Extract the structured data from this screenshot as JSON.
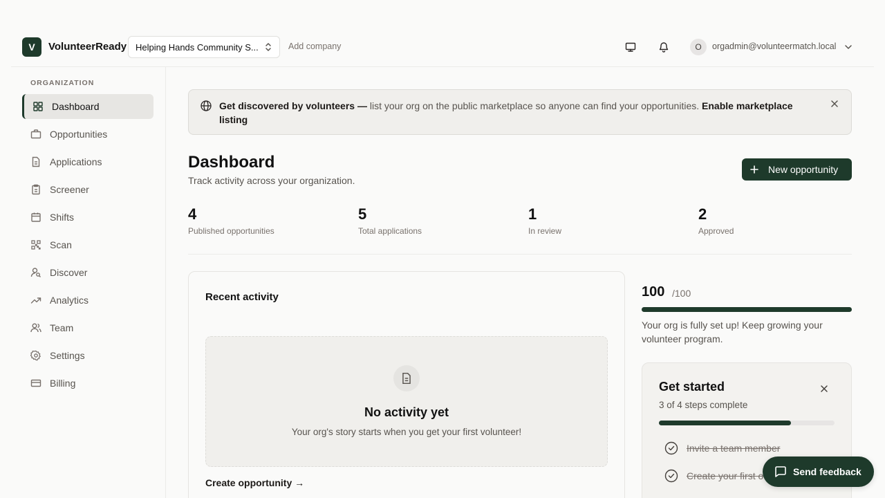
{
  "header": {
    "logo_letter": "V",
    "app_name": "VolunteerReady",
    "company_selected": "Helping Hands Community S...",
    "add_company": "Add company",
    "user_initial": "O",
    "user_email": "orgadmin@volunteermatch.local"
  },
  "sidebar": {
    "heading": "ORGANIZATION",
    "items": [
      {
        "label": "Dashboard",
        "icon": "dashboard-icon",
        "active": true
      },
      {
        "label": "Opportunities",
        "icon": "briefcase-icon"
      },
      {
        "label": "Applications",
        "icon": "document-icon"
      },
      {
        "label": "Screener",
        "icon": "clipboard-icon"
      },
      {
        "label": "Shifts",
        "icon": "calendar-icon"
      },
      {
        "label": "Scan",
        "icon": "qr-code-icon"
      },
      {
        "label": "Discover",
        "icon": "user-search-icon"
      },
      {
        "label": "Analytics",
        "icon": "trend-icon"
      },
      {
        "label": "Team",
        "icon": "users-icon"
      },
      {
        "label": "Settings",
        "icon": "gear-icon"
      },
      {
        "label": "Billing",
        "icon": "credit-card-icon"
      }
    ]
  },
  "banner": {
    "lead": "Get discovered by volunteers —",
    "body": " list your org on the public marketplace so anyone can find your opportunities. ",
    "action": "Enable marketplace listing"
  },
  "page": {
    "title": "Dashboard",
    "subtitle": "Track activity across your organization.",
    "new_button": "New opportunity"
  },
  "stats": [
    {
      "value": "4",
      "label": "Published opportunities"
    },
    {
      "value": "5",
      "label": "Total applications"
    },
    {
      "value": "1",
      "label": "In review"
    },
    {
      "value": "2",
      "label": "Approved"
    }
  ],
  "activity": {
    "title": "Recent activity",
    "empty_title": "No activity yet",
    "empty_sub": "Your org's story starts when you get your first volunteer!",
    "create_link": "Create opportunity →"
  },
  "score": {
    "value": "100",
    "max": "/100",
    "fraction": 1.0,
    "message": "Your org is fully set up! Keep growing your volunteer program."
  },
  "get_started": {
    "title": "Get started",
    "progress_text": "3 of 4 steps complete",
    "fraction": 0.75,
    "steps": [
      {
        "label": "Invite a team member",
        "done": true
      },
      {
        "label": "Create your first o",
        "done": true
      }
    ]
  },
  "feedback": {
    "label": "Send feedback"
  },
  "colors": {
    "brand": "#1e3a2b",
    "background": "#fafaf9"
  }
}
